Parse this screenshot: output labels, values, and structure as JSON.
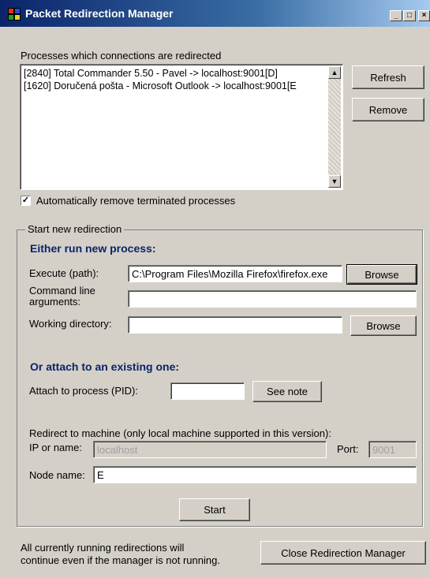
{
  "window": {
    "title": "Packet Redirection Manager",
    "controls": [
      "_",
      "□",
      "×"
    ]
  },
  "processes": {
    "label": "Processes which connections are redirected",
    "items": [
      "[2840] Total Commander 5.50 - Pavel -> localhost:9001[D]",
      "[1620] Doručená pošta - Microsoft Outlook -> localhost:9001[E"
    ],
    "refresh_label": "Refresh",
    "remove_label": "Remove"
  },
  "auto_remove": {
    "label": "Automatically remove terminated processes",
    "checked": true
  },
  "group": {
    "title": "Start new redirection",
    "run_heading": "Either run new process:",
    "execute_label": "Execute (path):",
    "execute_value": "C:\\Program Files\\Mozilla Firefox\\firefox.exe",
    "browse_label": "Browse",
    "args_label_1": "Command line",
    "args_label_2": "arguments:",
    "args_value": "",
    "workdir_label": "Working directory:",
    "workdir_value": "",
    "attach_heading": "Or attach to an existing one:",
    "pid_label": "Attach to process (PID):",
    "pid_value": "",
    "see_note_label": "See note",
    "redirect_label": "Redirect to machine (only local machine supported in this version):",
    "ip_label": "IP or name:",
    "ip_value": "localhost",
    "port_label": "Port:",
    "port_value": "9001",
    "node_label": "Node name:",
    "node_value": "E",
    "start_label": "Start"
  },
  "footer": {
    "note_line1": "All currently running redirections will",
    "note_line2": "continue even if the manager is not running.",
    "close_label": "Close Redirection Manager"
  }
}
